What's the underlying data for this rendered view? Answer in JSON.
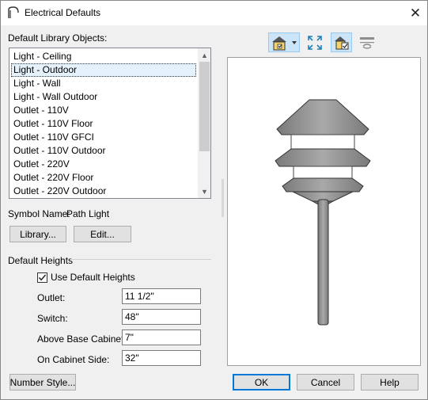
{
  "window": {
    "title": "Electrical Defaults",
    "close_glyph": "✕"
  },
  "library": {
    "label": "Default Library Objects:",
    "items": [
      "Light - Ceiling",
      "Light - Outdoor",
      "Light - Wall",
      "Light - Wall Outdoor",
      "Outlet - 110V",
      "Outlet - 110V Floor",
      "Outlet - 110V GFCI",
      "Outlet - 110V Outdoor",
      "Outlet - 220V",
      "Outlet - 220V Floor",
      "Outlet - 220V Outdoor"
    ],
    "selected_index": 1
  },
  "symbol": {
    "label": "Symbol Name:",
    "value": "Path Light"
  },
  "buttons": {
    "library": "Library...",
    "edit": "Edit...",
    "number_style": "Number Style...",
    "ok": "OK",
    "cancel": "Cancel",
    "help": "Help"
  },
  "heights": {
    "group_label": "Default Heights",
    "use_default_label": "Use Default Heights",
    "use_default_checked": true,
    "fields": [
      {
        "label": "Outlet:",
        "value": "11 1/2\""
      },
      {
        "label": "Switch:",
        "value": "48\""
      },
      {
        "label": "Above Base Cabinet:",
        "value": "7\""
      },
      {
        "label": "On Cabinet Side:",
        "value": "32\""
      }
    ]
  },
  "toolbar": {
    "icons": [
      "camera-view-icon",
      "fill-window-icon",
      "view-options-icon",
      "section-view-icon"
    ]
  },
  "colors": {
    "selection": "#e5f1fb",
    "accent": "#0078d7",
    "lamp_body": "#8c8c8c"
  }
}
